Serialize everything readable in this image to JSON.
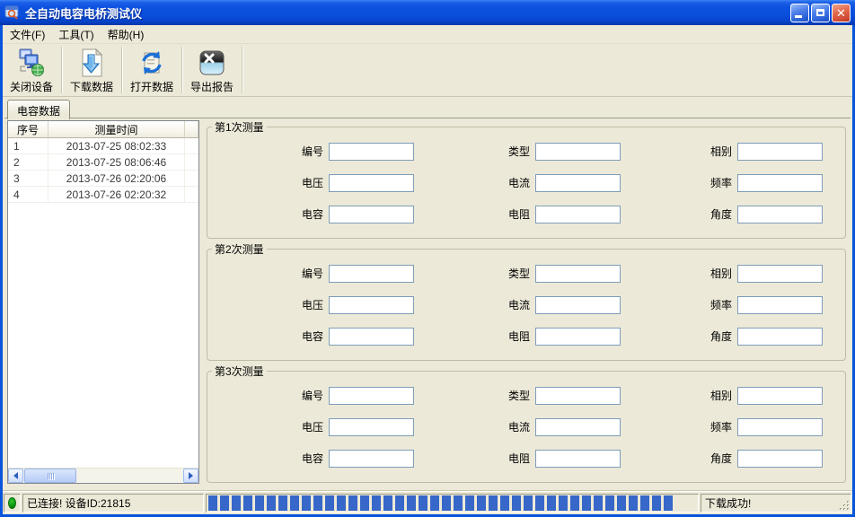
{
  "window": {
    "title": "全自动电容电桥测试仪",
    "controls": {
      "minimize": "minimize",
      "maximize": "maximize",
      "close": "close"
    }
  },
  "menu": {
    "items": [
      {
        "label": "文件(F)"
      },
      {
        "label": "工具(T)"
      },
      {
        "label": "帮助(H)"
      }
    ]
  },
  "toolbar": {
    "buttons": [
      {
        "label": "关闭设备",
        "icon": "network-devices-icon"
      },
      {
        "label": "下载数据",
        "icon": "download-document-icon"
      },
      {
        "label": "打开数据",
        "icon": "refresh-document-icon"
      },
      {
        "label": "导出报告",
        "icon": "export-excel-icon"
      }
    ]
  },
  "tabs": [
    {
      "label": "电容数据",
      "selected": true
    }
  ],
  "table": {
    "columns": [
      "序号",
      "测量时间"
    ],
    "rows": [
      [
        "1",
        "2013-07-25 08:02:33"
      ],
      [
        "2",
        "2013-07-25 08:06:46"
      ],
      [
        "3",
        "2013-07-26 02:20:06"
      ],
      [
        "4",
        "2013-07-26 02:20:32"
      ]
    ]
  },
  "groups": [
    {
      "title": "第1次测量"
    },
    {
      "title": "第2次测量"
    },
    {
      "title": "第3次测量"
    }
  ],
  "field_defs": [
    {
      "name": "number",
      "label": "编号",
      "value": ""
    },
    {
      "name": "type",
      "label": "类型",
      "value": ""
    },
    {
      "name": "phase",
      "label": "相别",
      "value": ""
    },
    {
      "name": "voltage",
      "label": "电压",
      "value": ""
    },
    {
      "name": "current",
      "label": "电流",
      "value": ""
    },
    {
      "name": "frequency",
      "label": "频率",
      "value": ""
    },
    {
      "name": "capacitance",
      "label": "电容",
      "value": ""
    },
    {
      "name": "resistance",
      "label": "电阻",
      "value": ""
    },
    {
      "name": "angle",
      "label": "角度",
      "value": ""
    }
  ],
  "statusbar": {
    "connection": "已连接! 设备ID:21815",
    "message": "下载成功!",
    "progress_percent": 100,
    "progress_segments": 40
  },
  "colors": {
    "titlebar_blue": "#0a4edc",
    "window_border": "#0855dd",
    "client_bg": "#ece9d8",
    "progress_block": "#3667c9",
    "led_green": "#0a8f0a",
    "input_border": "#7f9db9"
  }
}
